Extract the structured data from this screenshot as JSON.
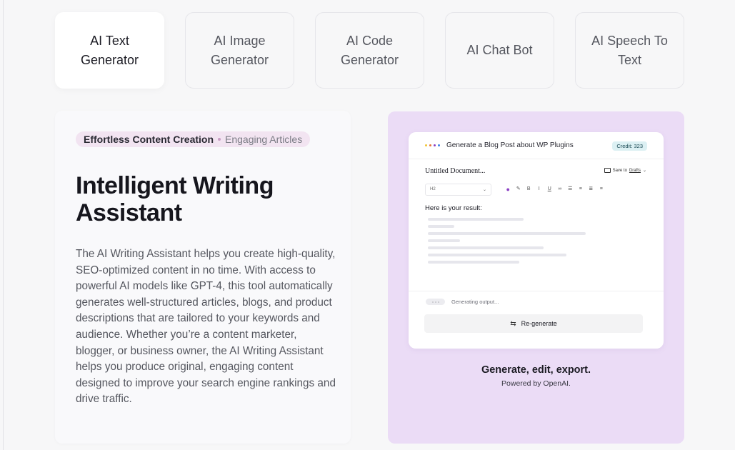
{
  "tabs": [
    {
      "label": "AI Text Generator",
      "active": true
    },
    {
      "label": "AI Image Generator",
      "active": false
    },
    {
      "label": "AI Code Generator",
      "active": false
    },
    {
      "label": "AI Chat Bot",
      "active": false
    },
    {
      "label": "AI Speech To Text",
      "active": false
    }
  ],
  "feature": {
    "tag_primary": "Effortless Content Creation",
    "tag_secondary": "Engaging Articles",
    "headline": "Intelligent Writing Assistant",
    "description": "The AI Writing Assistant helps you create high-quality, SEO-optimized content in no time. With access to powerful AI models like GPT-4, this tool automatically generates well-structured articles, blogs, and product descriptions that are tailored to your keywords and audience. Whether you’re a content marketer, blogger, or business owner, the AI Writing Assistant helps you produce original, engaging content designed to improve your search engine rankings and drive traffic."
  },
  "preview": {
    "prompt_title": "Generate a Blog Post about WP Plugins",
    "credit_label": "Credit: 323",
    "document_title": "Untitled Document...",
    "save_label": "Save to",
    "save_link": "Drafts",
    "heading_select": "H2",
    "result_label": "Here is your result:",
    "generating_label": "Generating output...",
    "regenerate_label": "Re-generate",
    "caption": "Generate, edit, export.",
    "sub_caption": "Powered by OpenAI.",
    "dot_colors": [
      "#f0c431",
      "#e8743b",
      "#8b3fc4",
      "#3b82e8"
    ]
  },
  "colors": {
    "accent_purple": "#ebdcf6",
    "pill_bg": "#f2e4f1",
    "credit_bg": "#dcf0f3"
  }
}
